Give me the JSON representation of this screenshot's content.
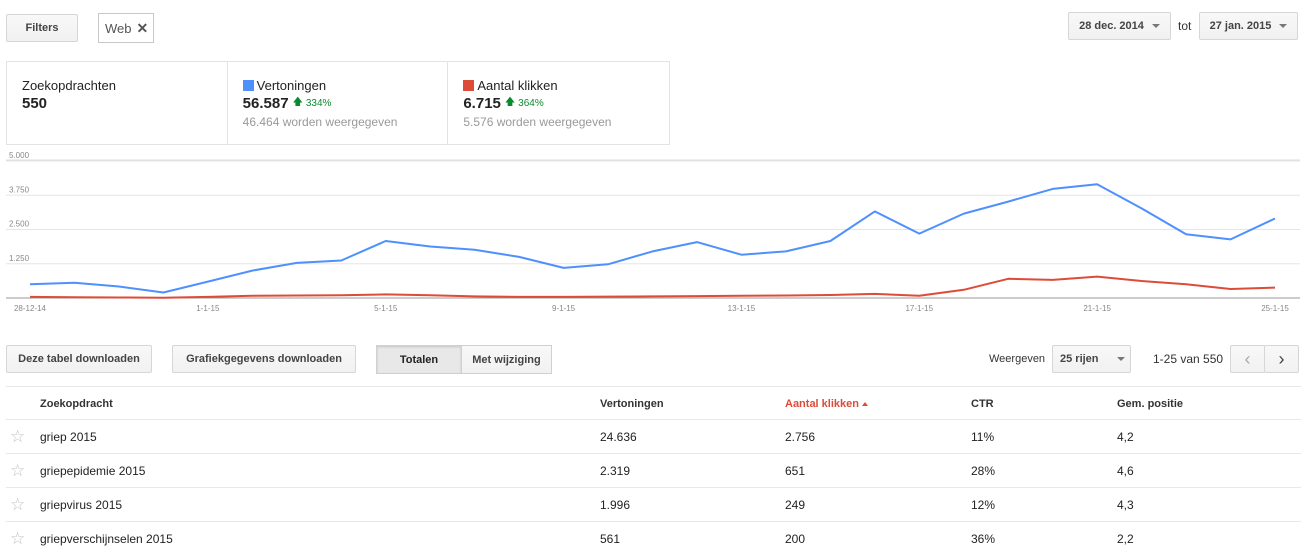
{
  "toolbar": {
    "filters_label": "Filters",
    "filter_chip": "Web",
    "date_from": "28 dec. 2014",
    "date_separator": "tot",
    "date_to": "27 jan. 2015"
  },
  "summary": [
    {
      "label": "Zoekopdrachten",
      "value": "550",
      "delta": "",
      "sub": "",
      "color": ""
    },
    {
      "label": "Vertoningen",
      "value": "56.587",
      "delta": "334%",
      "sub": "46.464 worden weergegeven",
      "color": "#4d90fe"
    },
    {
      "label": "Aantal klikken",
      "value": "6.715",
      "delta": "364%",
      "sub": "5.576 worden weergegeven",
      "color": "#dd4b39"
    }
  ],
  "chart_data": {
    "type": "line",
    "x": [
      "28-12-14",
      "29-12-14",
      "30-12-14",
      "31-12-14",
      "1-1-15",
      "2-1-15",
      "3-1-15",
      "4-1-15",
      "5-1-15",
      "6-1-15",
      "7-1-15",
      "8-1-15",
      "9-1-15",
      "10-1-15",
      "11-1-15",
      "12-1-15",
      "13-1-15",
      "14-1-15",
      "15-1-15",
      "16-1-15",
      "17-1-15",
      "18-1-15",
      "19-1-15",
      "20-1-15",
      "21-1-15",
      "22-1-15",
      "23-1-15",
      "24-1-15",
      "25-1-15"
    ],
    "x_tick_labels": [
      "28-12-14",
      "1-1-15",
      "5-1-15",
      "9-1-15",
      "13-1-15",
      "17-1-15",
      "21-1-15",
      "25-1-15"
    ],
    "y_tick_labels": [
      "1.250",
      "2.500",
      "3.750",
      "5.000"
    ],
    "ylim": [
      0,
      5000
    ],
    "grid": true,
    "series": [
      {
        "name": "Vertoningen",
        "color": "#4d90fe",
        "values": [
          500,
          560,
          420,
          200,
          600,
          1000,
          1280,
          1370,
          2080,
          1880,
          1760,
          1500,
          1100,
          1230,
          1700,
          2040,
          1580,
          1700,
          2080,
          3160,
          2350,
          3080,
          3520,
          3980,
          4150,
          3270,
          2330,
          2140,
          2900
        ]
      },
      {
        "name": "Aantal klikken",
        "color": "#dd4b39",
        "values": [
          40,
          30,
          20,
          10,
          40,
          80,
          90,
          100,
          130,
          100,
          60,
          40,
          40,
          50,
          60,
          70,
          80,
          90,
          110,
          150,
          80,
          300,
          700,
          660,
          780,
          620,
          500,
          330,
          380
        ]
      }
    ]
  },
  "actions": {
    "download_table": "Deze tabel downloaden",
    "download_chart": "Grafiekgegevens downloaden",
    "seg_totals": "Totalen",
    "seg_change": "Met wijziging",
    "show_label": "Weergeven",
    "rows_value": "25 rijen",
    "range_text": "1-25 van 550",
    "prev": "‹",
    "next": "›"
  },
  "table": {
    "headers": {
      "query": "Zoekopdracht",
      "impressions": "Vertoningen",
      "clicks": "Aantal klikken",
      "ctr": "CTR",
      "position": "Gem. positie"
    },
    "rows": [
      {
        "query": "griep 2015",
        "impressions": "24.636",
        "clicks": "2.756",
        "ctr": "11%",
        "position": "4,2"
      },
      {
        "query": "griepepidemie 2015",
        "impressions": "2.319",
        "clicks": "651",
        "ctr": "28%",
        "position": "4,6"
      },
      {
        "query": "griepvirus 2015",
        "impressions": "1.996",
        "clicks": "249",
        "ctr": "12%",
        "position": "4,3"
      },
      {
        "query": "griepverschijnselen 2015",
        "impressions": "561",
        "clicks": "200",
        "ctr": "36%",
        "position": "2,2"
      }
    ]
  }
}
